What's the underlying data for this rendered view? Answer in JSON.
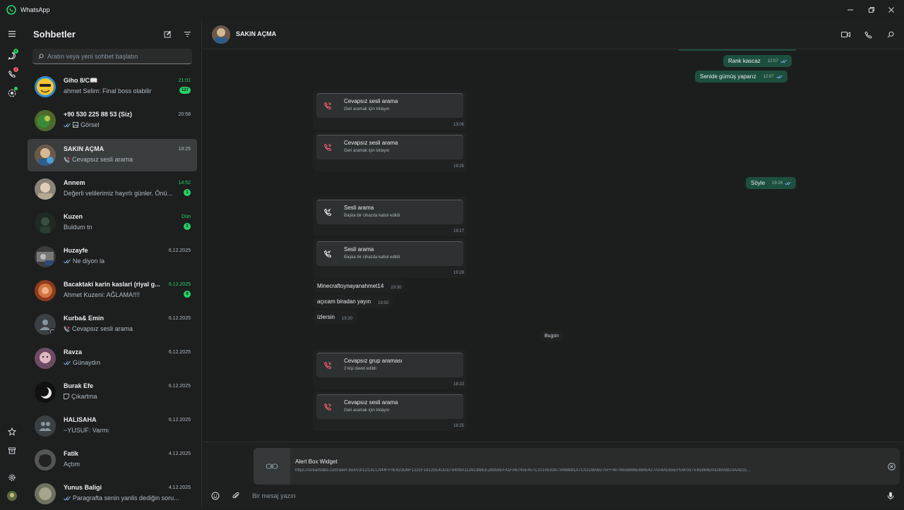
{
  "window": {
    "title": "WhatsApp",
    "accent": "#25d366",
    "missed_call_color": "#f15c6d"
  },
  "rail": {
    "chats_badge": "8",
    "calls_badge": "2"
  },
  "sidebar": {
    "title": "Sohbetler",
    "search_placeholder": "Aratın veya yeni sohbet başlatın",
    "chats": [
      {
        "name": "Giho 8/C📖",
        "preview": "ahmet Selim: Final boss olabilir",
        "time": "21:01",
        "badge": "127",
        "unread": true
      },
      {
        "name": "+90 530 225 88 53 (Siz)",
        "preview": "Görsel",
        "time": "20:58",
        "badge": "",
        "unread": false
      },
      {
        "name": "SAKIN AÇMA",
        "preview": "Cevapsız sesli arama",
        "time": "18:25",
        "badge": "",
        "unread": false
      },
      {
        "name": "Annem",
        "preview": "Değerli velilerimiz hayırlı günler. Önü...",
        "time": "14:52",
        "badge": "1",
        "unread": true
      },
      {
        "name": "Kuzen",
        "preview": "Buldum tn",
        "time": "Dün",
        "badge": "1",
        "unread": true
      },
      {
        "name": "Huzayfe",
        "preview": "Ne diyon la",
        "time": "6.12.2025",
        "badge": "",
        "unread": false
      },
      {
        "name": "Bacaktaki karin kaslari (riyal g...",
        "preview": "Ahmet Kuzeni: AĞLAMA!!!!",
        "time": "6.12.2025",
        "badge": "8",
        "unread": true
      },
      {
        "name": "Kurba& Emin",
        "preview": "Cevapsız sesli arama",
        "time": "6.12.2025",
        "badge": "",
        "unread": false
      },
      {
        "name": "Ravza",
        "preview": "Günaydın",
        "time": "6.12.2025",
        "badge": "",
        "unread": false
      },
      {
        "name": "Burak Efe",
        "preview": "Çıkartma",
        "time": "6.12.2025",
        "badge": "",
        "unread": false
      },
      {
        "name": "HALISAHA",
        "preview": "~YUSUF: Varmı",
        "time": "6.12.2025",
        "badge": "",
        "unread": false
      },
      {
        "name": "Fatik",
        "preview": "Açtım",
        "time": "4.12.2025",
        "badge": "",
        "unread": false
      },
      {
        "name": "Yunus Baligi",
        "preview": "Paragrafta senin yanlis dediğin soru...",
        "time": "4.12.2025",
        "badge": "",
        "unread": false
      }
    ]
  },
  "conversation": {
    "name": "SAKIN AÇMA",
    "outgoing": [
      {
        "text": "Rank kascaz",
        "time": "12:07"
      },
      {
        "text": "Senide gümüş yaparız",
        "time": "12:07"
      },
      {
        "text": "Söyle",
        "time": "19:26"
      }
    ],
    "calls": [
      {
        "title": "Cevapsız sesli arama",
        "sub": "Geri aramak için tıklayın",
        "time": "13:06",
        "missed": true
      },
      {
        "title": "Cevapsız sesli arama",
        "sub": "Geri aramak için tıklayın",
        "time": "19:25",
        "missed": true
      },
      {
        "title": "Sesli arama",
        "sub": "Başka bir cihazda kabul edildi",
        "time": "19:27",
        "missed": false
      },
      {
        "title": "Sesli arama",
        "sub": "Başka bir cihazda kabul edildi",
        "time": "19:29",
        "missed": false
      },
      {
        "title": "Cevapsız grup araması",
        "sub": "2 kişi davet edildi",
        "time": "18:23",
        "missed": true
      },
      {
        "title": "Cevapsız sesli arama",
        "sub": "Geri aramak için tıklayın",
        "time": "18:25",
        "missed": true
      }
    ],
    "incoming": [
      {
        "text": "Minecraftoynayanahmet14",
        "time": "19:30"
      },
      {
        "text": "açıcam biradan yayın",
        "time": "19:30"
      },
      {
        "text": "izlersin",
        "time": "19:30"
      }
    ],
    "day_chip": "Bugün"
  },
  "composer": {
    "preview_title": "Alert Box Widget",
    "preview_url": "https://streamlabs.com/alert-box/v3/1D13CC444FF0E623DBF1231F18120E4DDD78409A1126CBBEE28959EFA1FA6745E457C1014E83873488881A7C02D9A6D75FF4879858886E6845427AA4AEB5EFE60327E61864D0328A0B23AA815...",
    "placeholder": "Bir mesaj yazın"
  }
}
